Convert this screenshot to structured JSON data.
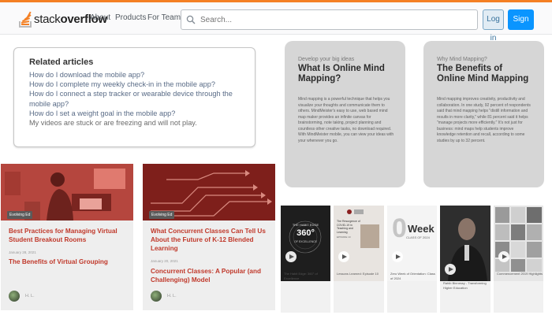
{
  "header": {
    "logo_light": "stack",
    "logo_bold": "overflow",
    "nav": [
      "About",
      "Products",
      "For Teams"
    ],
    "search_placeholder": "Search...",
    "login_label": "Log in",
    "signup_label": "Sign up"
  },
  "related": {
    "title": "Related articles",
    "links": [
      "How do I download the mobile app?",
      "How do I complete my weekly check-in in the mobile app?",
      "How do I connect a step tracker or wearable device through the mobile app?",
      "How do I set a weight goal in the mobile app?",
      "My videos are stuck or are freezing and will not play."
    ]
  },
  "info_cards": [
    {
      "kicker": "Develop your big ideas",
      "title": "What Is Online Mind Mapping?",
      "body": "Mind mapping is a powerful technique that helps you visualize your thoughts and communicate them to others. MindMeister's easy to use, web based mind map maker provides an infinite canvas for brainstorming, note taking, project planning and countless other creative tasks, no download required. With MindMeister mobile, you can view your ideas with your whenever you go."
    },
    {
      "kicker": "Why Mind Mapping?",
      "title": "The Benefits of Online Mind Mapping",
      "body": "Mind mapping improves creativity, productivity and collaboration. In one study, 92 percent of respondents said that mind mapping helps \"distill information and results in more clarity,\" while 81 percent said it helps \"manage projects more efficiently.\" It's not just for business: mind maps help students improve knowledge retention and recall, according to some studies by up to 32 percent."
    }
  ],
  "articles": [
    {
      "tag": "Evolving Ed",
      "title": "Best Practices for Managing Virtual Student Breakout Rooms",
      "date": "January 28, 2021",
      "subtitle": "The Benefits of Virtual Grouping",
      "author": "H. L."
    },
    {
      "tag": "Evolving Ed",
      "title": "What Concurrent Classes Can Tell Us About the Future of K-12 Blended Learning",
      "date": "January 20, 2021",
      "subtitle": "Concurrent Classes: A Popular (and Challenging) Model",
      "author": "H. L."
    }
  ],
  "videos": [
    {
      "thumb_title": "THE HABIT EDGE",
      "thumb_big": "360°",
      "thumb_sub": "OF EXCELLENCE",
      "caption": "The Habit Edge: 360° of Excellence"
    },
    {
      "thumb_title": "The Resurgence of COVID-19 in Teaching and Learning",
      "thumb_sub": "EPISODE 10",
      "caption": "Lessons Learned: Episode 10"
    },
    {
      "thumb_big": "0",
      "thumb_title": "Week",
      "thumb_sub": "CLASS OF 2024",
      "caption": "Zero Week of Orientation: Class of 2024"
    },
    {
      "thumb_title": "",
      "caption": "Rahib Binnessy - Transforming Higher Education"
    },
    {
      "thumb_title": "",
      "caption": "Commencement 2019 Highlights"
    }
  ],
  "colors": {
    "accent_orange": "#f48024",
    "link_blue": "#596b86",
    "article_red": "#c0392b",
    "signup_blue": "#0a95ff"
  }
}
